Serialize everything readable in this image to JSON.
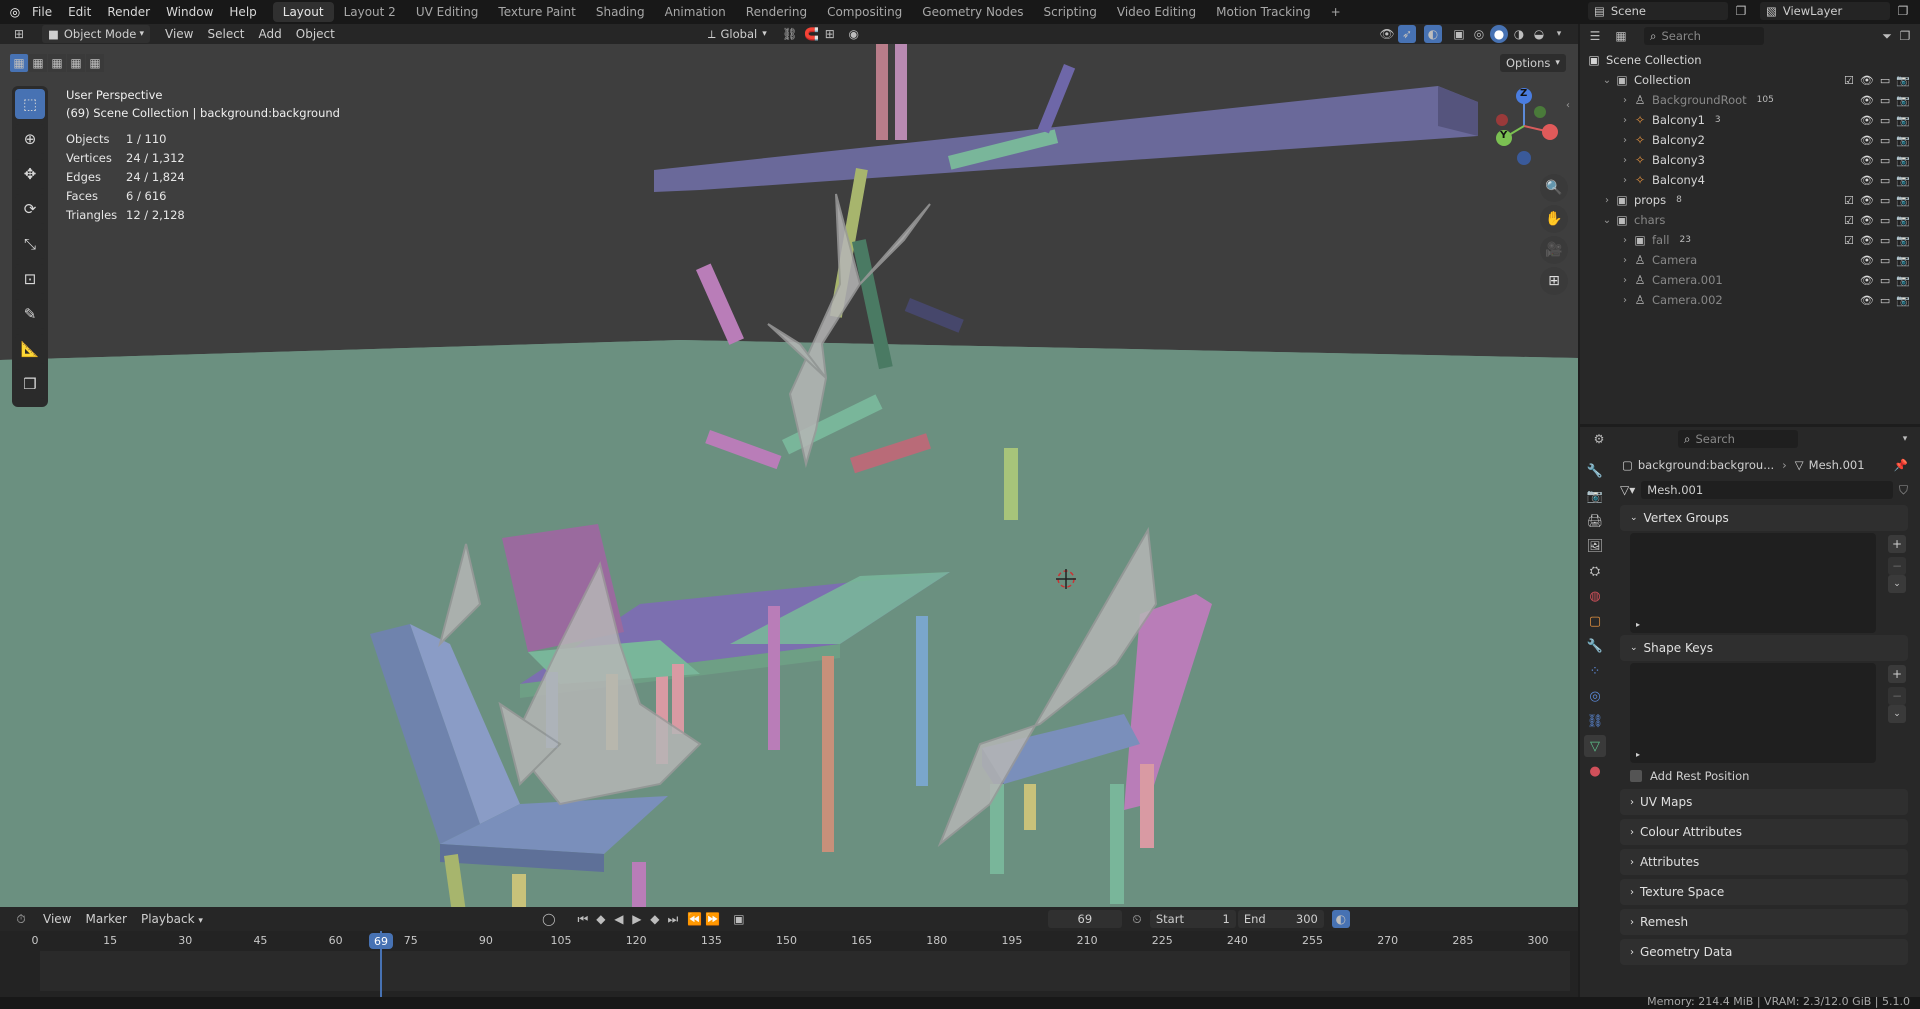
{
  "topbar": {
    "menus": [
      "File",
      "Edit",
      "Render",
      "Window",
      "Help"
    ],
    "workspaces": [
      "Layout",
      "Layout 2",
      "UV Editing",
      "Texture Paint",
      "Shading",
      "Animation",
      "Rendering",
      "Compositing",
      "Geometry Nodes",
      "Scripting",
      "Video Editing",
      "Motion Tracking"
    ],
    "active_workspace": "Layout",
    "add_tab_icon": "+",
    "scene": "Scene",
    "view_layer": "ViewLayer"
  },
  "viewport_header": {
    "mode": "Object Mode",
    "menus": [
      "View",
      "Select",
      "Add",
      "Object"
    ],
    "transform_orientation": "Global",
    "options": "Options"
  },
  "viewport": {
    "perspective": "User Perspective",
    "collection_info": "(69) Scene Collection | background:background",
    "stats": [
      {
        "label": "Objects",
        "value": "1 / 110"
      },
      {
        "label": "Vertices",
        "value": "24 / 1,312"
      },
      {
        "label": "Edges",
        "value": "24 / 1,824"
      },
      {
        "label": "Faces",
        "value": "6 / 616"
      },
      {
        "label": "Triangles",
        "value": "12 / 2,128"
      }
    ],
    "gizmo_labels": {
      "z": "Z",
      "y": "Y",
      "x": "X"
    }
  },
  "outliner": {
    "search_placeholder": "Search",
    "root": "Scene Collection",
    "items": [
      {
        "label": "Collection",
        "indent": 0
      },
      {
        "label": "BackgroundRoot",
        "indent": 1,
        "badge": "105"
      },
      {
        "label": "Balcony1",
        "indent": 1,
        "badge": "3"
      },
      {
        "label": "Balcony2",
        "indent": 1
      },
      {
        "label": "Balcony3",
        "indent": 1
      },
      {
        "label": "Balcony4",
        "indent": 1
      },
      {
        "label": "props",
        "indent": 0,
        "badge": "8"
      },
      {
        "label": "chars",
        "indent": 0
      },
      {
        "label": "fall",
        "indent": 1,
        "badge": "23"
      },
      {
        "label": "Camera",
        "indent": 1
      },
      {
        "label": "Camera.001",
        "indent": 1
      },
      {
        "label": "Camera.002",
        "indent": 1
      }
    ]
  },
  "properties": {
    "search_placeholder": "Search",
    "breadcrumb_object": "background:backgrou...",
    "breadcrumb_mesh": "Mesh.001",
    "mesh_name": "Mesh.001",
    "panels_open": [
      "Vertex Groups",
      "Shape Keys"
    ],
    "add_rest_position": "Add Rest Position",
    "panels_closed": [
      "UV Maps",
      "Colour Attributes",
      "Attributes",
      "Texture Space",
      "Remesh",
      "Geometry Data"
    ]
  },
  "timeline": {
    "menus": [
      "View",
      "Marker"
    ],
    "playback": "Playback",
    "current_frame": "69",
    "start_label": "Start",
    "start": "1",
    "end_label": "End",
    "end": "300",
    "ticks": [
      "0",
      "15",
      "30",
      "45",
      "60",
      "75",
      "90",
      "105",
      "120",
      "135",
      "150",
      "165",
      "180",
      "195",
      "210",
      "225",
      "240",
      "255",
      "270",
      "285",
      "300"
    ]
  },
  "statusbar": {
    "text": "Memory: 214.4 MiB | VRAM: 2.3/12.0 GiB | 5.1.0"
  },
  "colors": {
    "viewport_floor": "#6b9080",
    "viewport_wall": "#3f3f3f",
    "accent": "#4772b3",
    "frame_marker": "#4772b3"
  }
}
